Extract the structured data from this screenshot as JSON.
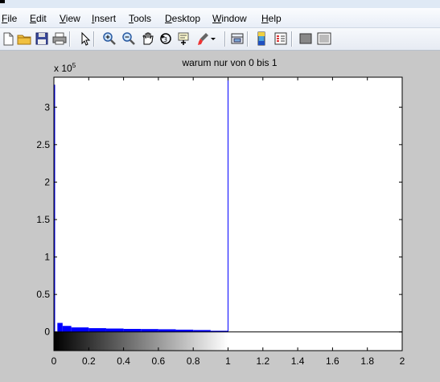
{
  "menubar": {
    "items": [
      {
        "label": "File",
        "accel": "F",
        "rest": "ile"
      },
      {
        "label": "Edit",
        "accel": "E",
        "rest": "dit"
      },
      {
        "label": "View",
        "accel": "V",
        "rest": "iew"
      },
      {
        "label": "Insert",
        "accel": "I",
        "rest": "nsert"
      },
      {
        "label": "Tools",
        "accel": "T",
        "rest": "ools"
      },
      {
        "label": "Desktop",
        "accel": "D",
        "rest": "esktop"
      },
      {
        "label": "Window",
        "accel": "W",
        "rest": "indow"
      },
      {
        "label": "Help",
        "accel": "H",
        "rest": "elp"
      }
    ]
  },
  "toolbar": {
    "buttons": [
      {
        "name": "new-figure",
        "icon": "new-file-icon"
      },
      {
        "name": "open-file",
        "icon": "folder-icon"
      },
      {
        "name": "save-figure",
        "icon": "floppy-disk-icon"
      },
      {
        "name": "print-figure",
        "icon": "printer-icon"
      },
      {
        "name": "edit-plot",
        "icon": "arrow-cursor-icon"
      },
      {
        "name": "zoom-in",
        "icon": "zoom-in-icon"
      },
      {
        "name": "zoom-out",
        "icon": "zoom-out-icon"
      },
      {
        "name": "pan",
        "icon": "hand-icon"
      },
      {
        "name": "rotate-3d",
        "icon": "rotate-icon"
      },
      {
        "name": "data-cursor",
        "icon": "data-cursor-icon"
      },
      {
        "name": "brush",
        "icon": "brush-icon"
      },
      {
        "name": "link-plot",
        "icon": "link-plot-icon"
      },
      {
        "name": "insert-colorbar",
        "icon": "colorbar-icon"
      },
      {
        "name": "insert-legend",
        "icon": "legend-icon"
      },
      {
        "name": "hide-plot-tools",
        "icon": "hide-tools-icon"
      },
      {
        "name": "show-plot-tools",
        "icon": "show-tools-icon"
      }
    ]
  },
  "colors": {
    "histogram": "#0000ff",
    "background": "#c8c8c8",
    "axes_background": "#ffffff",
    "colorbar_start": "#000000",
    "colorbar_end": "#ffffff"
  },
  "chart_data": {
    "type": "bar",
    "title": "warum nur von 0 bis 1",
    "xlabel": "",
    "ylabel": "",
    "y_exponent_label": "x 10",
    "y_exponent": "5",
    "xlim": [
      0,
      2
    ],
    "ylim": [
      -25000,
      340000
    ],
    "x_ticks": [
      "0",
      "0.2",
      "0.4",
      "0.6",
      "0.8",
      "1",
      "1.2",
      "1.4",
      "1.6",
      "1.8",
      "2"
    ],
    "x_tick_values": [
      0,
      0.2,
      0.4,
      0.6,
      0.8,
      1,
      1.2,
      1.4,
      1.6,
      1.8,
      2
    ],
    "y_ticks": [
      "0",
      "0.5",
      "1",
      "1.5",
      "2",
      "2.5",
      "3"
    ],
    "y_tick_values": [
      0,
      50000,
      100000,
      150000,
      200000,
      250000,
      300000
    ],
    "grid": false,
    "colorbar": {
      "range": [
        0,
        1
      ],
      "colors": [
        "#000000",
        "#ffffff"
      ]
    },
    "vline": {
      "x": 1,
      "value_top": 340000
    },
    "bins": [
      {
        "x": 0.0,
        "value": 330000
      },
      {
        "x": 0.02,
        "value": 12000
      },
      {
        "x": 0.05,
        "value": 8000
      },
      {
        "x": 0.1,
        "value": 6000
      },
      {
        "x": 0.2,
        "value": 5000
      },
      {
        "x": 0.3,
        "value": 4500
      },
      {
        "x": 0.4,
        "value": 4000
      },
      {
        "x": 0.5,
        "value": 3800
      },
      {
        "x": 0.6,
        "value": 3500
      },
      {
        "x": 0.7,
        "value": 3000
      },
      {
        "x": 0.8,
        "value": 2500
      },
      {
        "x": 0.9,
        "value": 1500
      },
      {
        "x": 1.0,
        "value": 800
      }
    ]
  }
}
